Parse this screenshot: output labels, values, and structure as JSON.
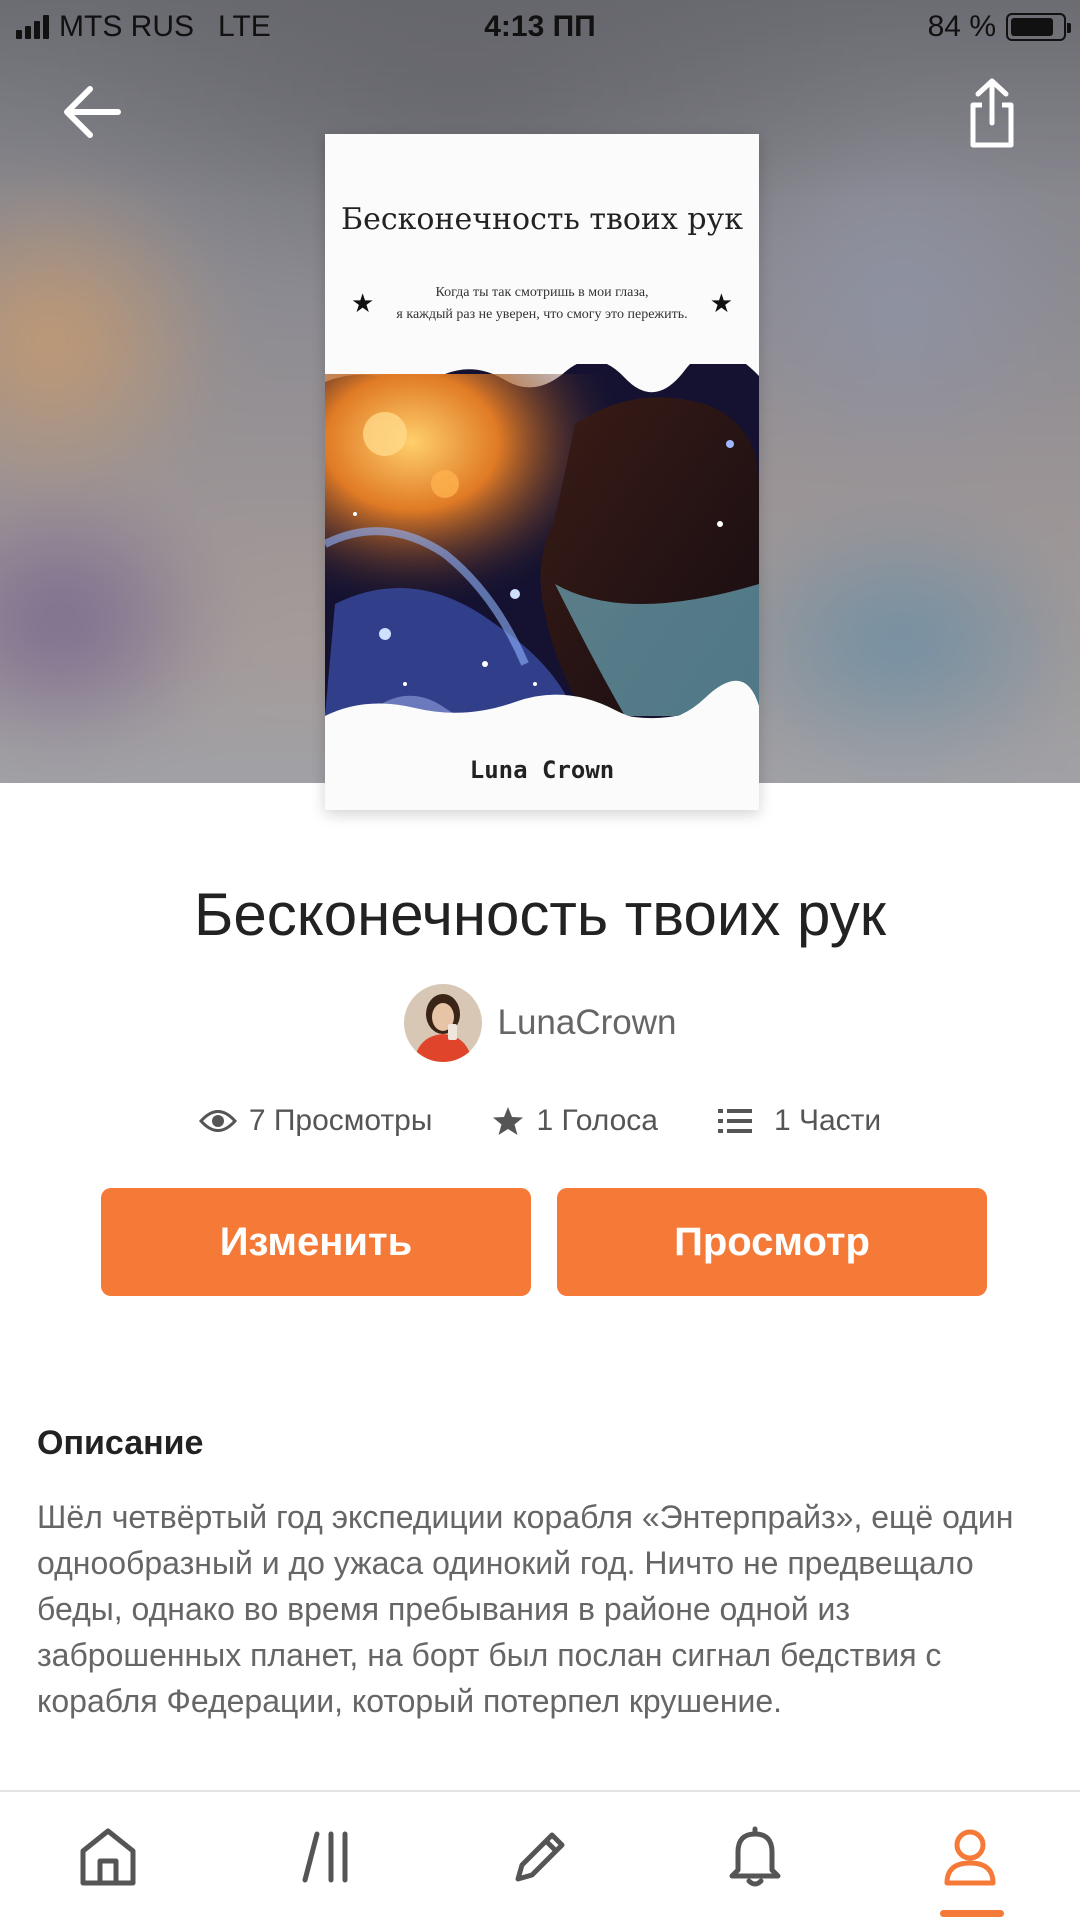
{
  "status_bar": {
    "carrier": "MTS RUS",
    "network": "LTE",
    "time": "4:13 ПП",
    "battery": "84 %",
    "battery_level": 0.84
  },
  "header": {
    "back_icon": "arrow-left-icon",
    "share_icon": "share-icon"
  },
  "cover": {
    "title": "Бесконечность твоих рук",
    "quote_line1": "Когда ты так смотришь в мои глаза,",
    "quote_line2": "я каждый раз не уверен, что смогу это пережить.",
    "author": "Luna Crown"
  },
  "story": {
    "title": "Бесконечность твоих рук",
    "author": "LunaCrown"
  },
  "stats": {
    "views": "7 Просмотры",
    "votes": "1 Голоса",
    "parts": "1 Части"
  },
  "actions": {
    "edit_label": "Изменить",
    "view_label": "Просмотр"
  },
  "description": {
    "heading": "Описание",
    "text": "Шёл четвёртый год экспедиции корабля «Энтерпрайз», ещё один однообразный и до ужаса одинокий год. Ничто не предвещало беды, однако во время пребывания в районе одной из заброшенных планет, на борт был послан сигнал бедствия с корабля Федерации, который потерпел крушение."
  },
  "bottom_nav": {
    "items": [
      "home-icon",
      "library-icon",
      "write-icon",
      "notifications-icon",
      "profile-icon"
    ],
    "active": "profile-icon"
  },
  "colors": {
    "accent": "#f57a38",
    "text_dark": "#222222",
    "text_muted": "#666666"
  }
}
